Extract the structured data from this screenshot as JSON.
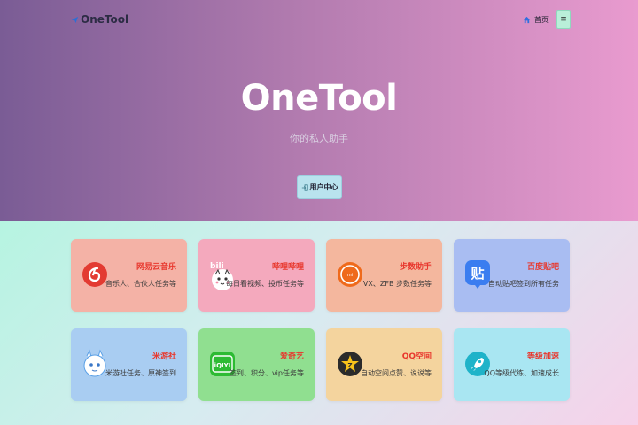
{
  "header": {
    "brand": "OneTool",
    "nav_home": "首页",
    "menu_icon_glyph": "≡"
  },
  "hero": {
    "title": "OneTool",
    "subtitle": "你的私人助手",
    "user_center_label": "用户中心"
  },
  "colors": {
    "hero_gradient": [
      "#7a5c95",
      "#b07aae",
      "#e99bcf"
    ],
    "title_red": "#e8382e"
  },
  "cards": [
    {
      "title": "网易云音乐",
      "desc": "音乐人、合伙人任务等",
      "icon": "netease-music-icon",
      "bg": "#f4b2a6"
    },
    {
      "title": "哔哩哔哩",
      "desc": "每日看视频、投币任务等",
      "icon": "bilibili-icon",
      "bg": "#f4a9bd"
    },
    {
      "title": "步数助手",
      "desc": "VX、ZFB 步数任务等",
      "icon": "xiaomi-steps-icon",
      "bg": "#f4b79e"
    },
    {
      "title": "百度贴吧",
      "desc": "自动贴吧签到所有任务",
      "icon": "baidu-tieba-icon",
      "bg": "#a9bdf2"
    },
    {
      "title": "米游社",
      "desc": "米游社任务、原神签到",
      "icon": "miyoushe-icon",
      "bg": "#a9cdf2"
    },
    {
      "title": "爱奇艺",
      "desc": "签到、积分、vip任务等",
      "icon": "iqiyi-icon",
      "bg": "#90df90"
    },
    {
      "title": "QQ空间",
      "desc": "自动空间点赞、说说等",
      "icon": "qzone-icon",
      "bg": "#f4d49e"
    },
    {
      "title": "等级加速",
      "desc": "QQ等级代练、加速成长",
      "icon": "rocket-icon",
      "bg": "#a9e6f2"
    }
  ]
}
